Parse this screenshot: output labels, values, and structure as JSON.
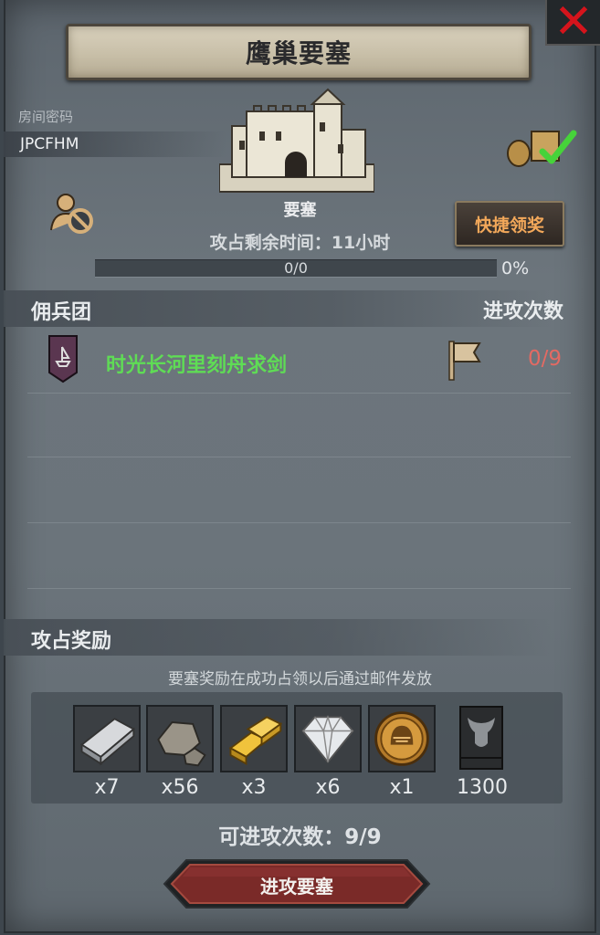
{
  "title": "鹰巢要塞",
  "room": {
    "label": "房间密码",
    "code": "JPCFHM"
  },
  "fortress": {
    "label": "要塞"
  },
  "quick_claim_label": "快捷领奖",
  "time_remaining": "攻占剩余时间：11小时",
  "progress": {
    "text": "0/0",
    "percent_label": "0%",
    "fraction": 0
  },
  "mercenary": {
    "header": "佣兵团",
    "attacks_header": "进攻次数",
    "rows": [
      {
        "name": "时光长河里刻舟求剑",
        "attacks": "0/9"
      }
    ]
  },
  "rewards": {
    "header": "攻占奖励",
    "note": "要塞奖励在成功占领以后通过邮件发放",
    "items": [
      {
        "icon": "silver-ingot-icon",
        "qty": "x7"
      },
      {
        "icon": "stone-icon",
        "qty": "x56"
      },
      {
        "icon": "gold-bars-icon",
        "qty": "x3"
      },
      {
        "icon": "diamond-icon",
        "qty": "x6"
      },
      {
        "icon": "knight-helmet-coin-icon",
        "qty": "x1"
      },
      {
        "icon": "bull-banner-icon",
        "qty": "1300"
      }
    ]
  },
  "attempts_remaining": "可进攻次数：9/9",
  "attack_button_label": "进攻要塞",
  "colors": {
    "accent_orange": "#f3a85a",
    "mercenary_name_green": "#5fdc55",
    "attack_count_red": "#e36a63",
    "close_red": "#d4141c"
  }
}
